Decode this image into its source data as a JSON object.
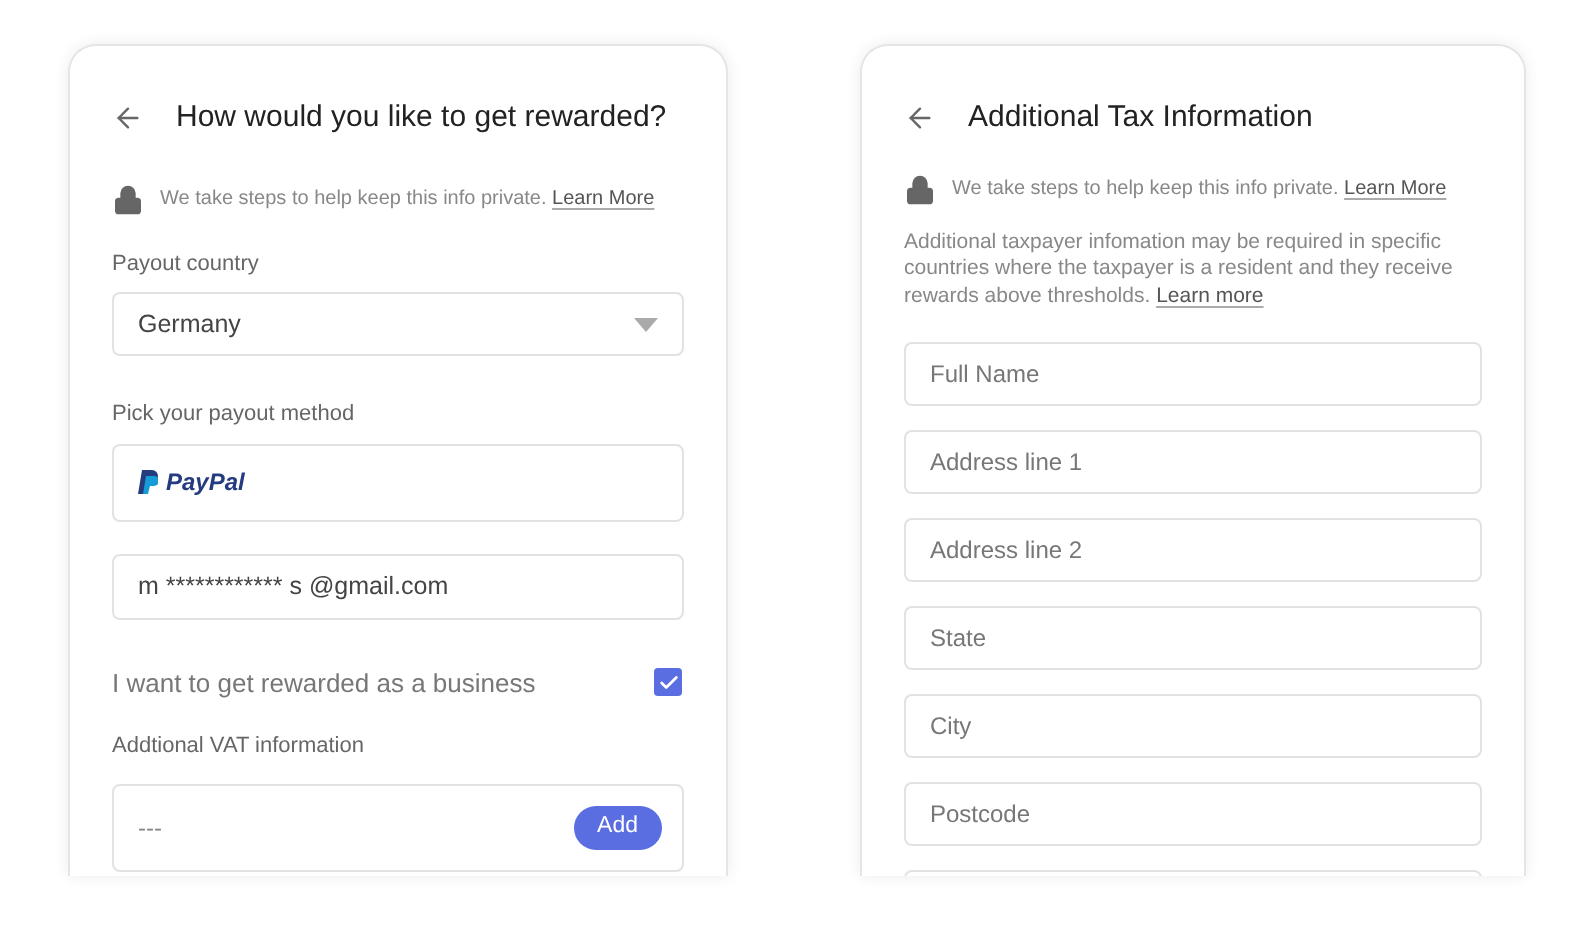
{
  "reward_card": {
    "title": "How would you like to get rewarded?",
    "privacy_note": "We take steps to help keep this info private.",
    "privacy_link": "Learn More",
    "country_label": "Payout country",
    "country_value": "Germany",
    "method_label": "Pick your payout method",
    "method_name": "PayPal",
    "email_value": "m ************ s @gmail.com",
    "business_label": "I want to get rewarded as a business",
    "business_checked": true,
    "vat_label": "Addtional VAT information",
    "vat_value": "---",
    "vat_button": "Add"
  },
  "tax_card": {
    "title": "Additional Tax Information",
    "privacy_note": "We take steps to help keep this info private.",
    "privacy_link": "Learn More",
    "description": "Additional taxpayer infomation may be required in specific countries where the taxpayer is a resident and they receive rewards above thresholds.",
    "description_link": "Learn more",
    "fields": [
      {
        "placeholder": "Full Name"
      },
      {
        "placeholder": "Address line 1"
      },
      {
        "placeholder": "Address line 2"
      },
      {
        "placeholder": "State"
      },
      {
        "placeholder": "City"
      },
      {
        "placeholder": "Postcode"
      }
    ]
  }
}
